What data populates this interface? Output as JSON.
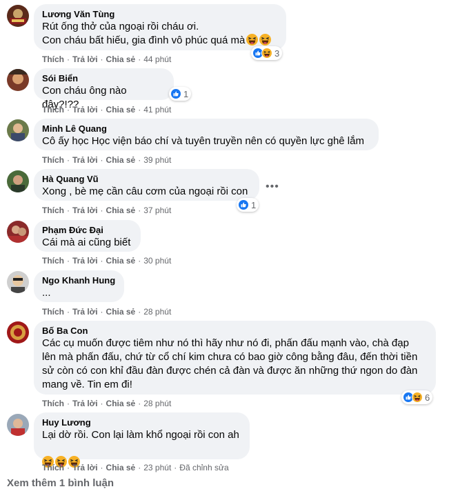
{
  "actions": {
    "like": "Thích",
    "reply": "Trả lời",
    "share": "Chia sẻ",
    "dot": "·"
  },
  "comments": [
    {
      "name": "Lương Văn Tùng",
      "lines": "Rút ống thở của ngoại rồi cháu ơi.\nCon cháu bất hiếu, gia đình vô phúc quá mà",
      "time": "44 phút",
      "reaction_count": "3",
      "reactions": [
        "like-icon",
        "haha-icon"
      ]
    },
    {
      "name": "Sói Biển",
      "lines": "Con cháu ông nào đây?!??",
      "time": "41 phút",
      "reaction_count": "1",
      "reactions": [
        "like-icon"
      ]
    },
    {
      "name": "Minh Lê Quang",
      "lines": "Cô ấy học Học viện báo chí và tuyên truyền nên có quyền lực ghê lắm",
      "time": "39 phút"
    },
    {
      "name": "Hà Quang Vũ",
      "lines": "Xong , bè mẹ cần câu cơm của ngoại rồi con",
      "time": "37 phút",
      "reaction_count": "1",
      "reactions": [
        "like-icon"
      ],
      "more": "•••"
    },
    {
      "name": "Phạm Đức Đại",
      "lines": "Cái mà ai cũng biết",
      "time": "30 phút"
    },
    {
      "name": "Ngo Khanh Hung",
      "lines": "...",
      "time": "28 phút"
    },
    {
      "name": "Bố Ba Con",
      "lines": "Các cụ muốn được tiêm như nó thì hãy như nó đi, phấn đấu mạnh vào, chà đạp\nlên mà phấn đấu, chứ từ cổ chí kim chưa có bao giờ công bằng đâu, đến thời tiền\nsử còn có con khỉ đầu đàn được chén cả đàn và được ăn những thứ ngon do đàn\nmang về. Tin em đi!",
      "time": "28 phút",
      "reaction_count": "6",
      "reactions": [
        "like-icon",
        "haha-icon"
      ]
    },
    {
      "name": "Huy Lương",
      "lines": "Lại dờ rồi. Con lại làm khổ ngoại rồi con ah",
      "time": "23 phút",
      "edited": "Đã chỉnh sửa"
    }
  ],
  "see_more": "Xem thêm 1 bình luận",
  "colors": {
    "bubble": "#f0f2f5",
    "meta": "#65676b",
    "like": "#1877f2",
    "haha": "#f7b125"
  }
}
